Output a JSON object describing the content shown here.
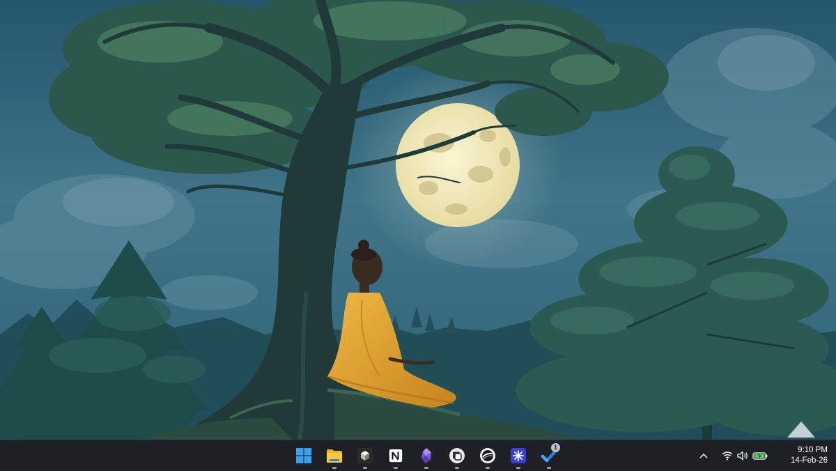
{
  "wallpaper": {
    "scene": "meditating figure under a tree with full moon",
    "colors": {
      "sky": "#3b6e84",
      "sky_dark": "#1d4457",
      "moon": "#eee8bd",
      "robe": "#e3a531",
      "foliage": "#2f5e54",
      "trunk": "#1f3a39"
    }
  },
  "taskbar": {
    "background": "#1d2126",
    "apps": [
      {
        "name": "Start",
        "icon": "windows-logo-icon",
        "running": false
      },
      {
        "name": "File Explorer",
        "icon": "folder-icon",
        "running": true
      },
      {
        "name": "App",
        "icon": "cube-app-icon",
        "running": true
      },
      {
        "name": "Notion",
        "icon": "notion-icon",
        "running": true
      },
      {
        "name": "Obsidian",
        "icon": "obsidian-icon",
        "running": true
      },
      {
        "name": "App",
        "icon": "rounded-square-app-icon",
        "running": true
      },
      {
        "name": "App",
        "icon": "sphere-app-icon",
        "running": true
      },
      {
        "name": "App",
        "icon": "starburst-app-icon",
        "running": true
      },
      {
        "name": "Microsoft To Do",
        "icon": "checkmark-app-icon",
        "running": true,
        "badge": "1"
      }
    ],
    "tray": {
      "overflow_icon": "chevron-up-icon",
      "icons": [
        "wifi-icon",
        "volume-icon",
        "battery-charging-icon"
      ],
      "time": "9:10 PM",
      "date": "14-Feb-26"
    }
  }
}
